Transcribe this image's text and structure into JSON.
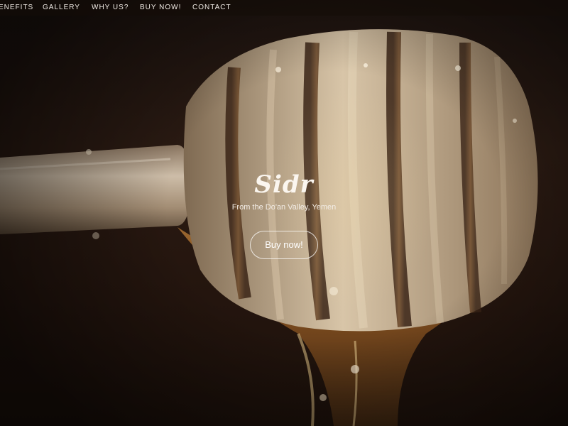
{
  "nav": {
    "items": [
      {
        "label": "ENEFITS"
      },
      {
        "label": "GALLERY"
      },
      {
        "label": "WHY US?"
      },
      {
        "label": "BUY NOW!"
      },
      {
        "label": "CONTACT"
      }
    ]
  },
  "hero": {
    "title": "Sidr",
    "subtitle": "From the Do'an Valley, Yemen",
    "cta_label": "Buy now!"
  },
  "colors": {
    "background": "#24150e",
    "wood": "#c9b08f",
    "honey": "#b07a3a",
    "text": "#fbf6ef"
  }
}
